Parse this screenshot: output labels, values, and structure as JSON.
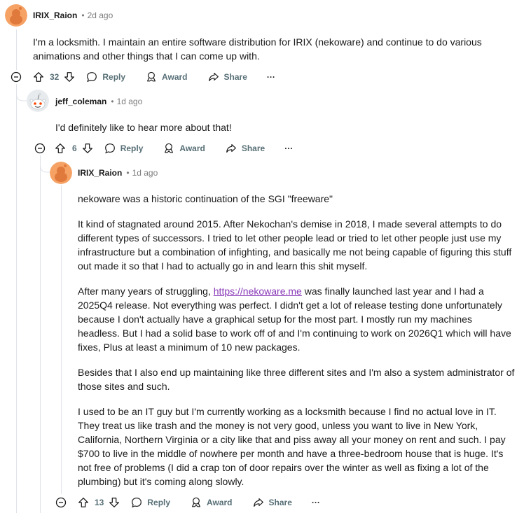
{
  "comments": [
    {
      "author": "IRIX_Raion",
      "time": "2d ago",
      "body": [
        "I'm a locksmith. I maintain an entire software distribution for IRIX (nekoware) and continue to do various animations and other things that I can come up with."
      ],
      "votes": "32"
    },
    {
      "author": "jeff_coleman",
      "time": "1d ago",
      "body": [
        "I'd definitely like to hear more about that!"
      ],
      "votes": "6"
    },
    {
      "author": "IRIX_Raion",
      "time": "1d ago",
      "body": [
        "nekoware was a historic continuation of the SGI \"freeware\"",
        "It kind of stagnated around 2015. After Nekochan's demise in 2018, I made several attempts to do different types of successors. I tried to let other people lead or tried to let other people just use my infrastructure but a combination of infighting, and basically me not being capable of figuring this stuff out made it so that I had to actually go in and learn this shit myself.",
        "Besides that I also end up maintaining like three different sites and I'm also a system administrator of those sites and such.",
        "I used to be an IT guy but I'm currently working as a locksmith because I find no actual love in IT. They treat us like trash and the money is not very good, unless you want to live in New York, California, Northern Virginia or a city like that and piss away all your money on rent and such. I pay $700 to live in the middle of nowhere per month and have a three-bedroom house that is huge. It's not free of problems (I did a crap ton of door repairs over the winter as well as fixing a lot of the plumbing) but it's coming along slowly."
      ],
      "p3_before": "After many years of struggling, ",
      "p3_link": "https://nekoware.me",
      "p3_after": " was finally launched last year and I had a 2025Q4 release. Not everything was perfect. I didn't get a lot of release testing done unfortunately because I don't actually have a graphical setup for the most part. I mostly run my machines headless. But I had a solid base to work off of and I'm continuing to work on 2026Q1 which will have fixes, Plus at least a minimum of 10 new packages.",
      "votes": "13"
    }
  ],
  "labels": {
    "reply": "Reply",
    "award": "Award",
    "share": "Share",
    "more": "···",
    "dot": "•"
  },
  "colors": {
    "avatar_orange": "#f6a265",
    "link": "#8a3ab9",
    "meta": "#7c7c7c",
    "action": "#576f76"
  }
}
